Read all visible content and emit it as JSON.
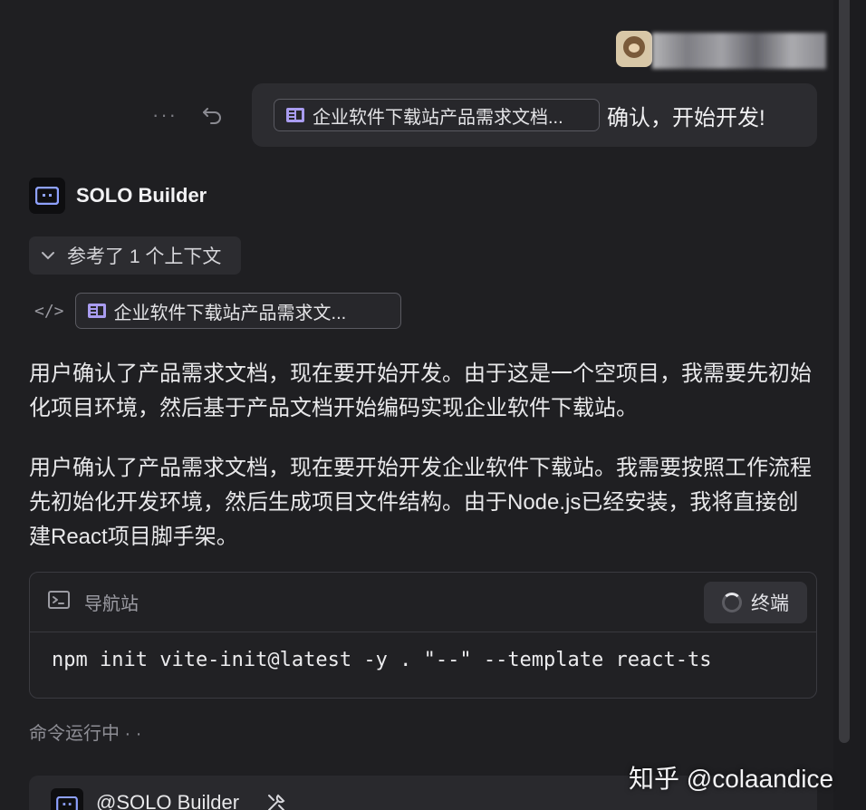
{
  "user": {
    "avatar_icon": "user-avatar-image",
    "name_blurred": true
  },
  "user_message": {
    "attachment_label": "企业软件下载站产品需求文档...",
    "text": "确认，开始开发!",
    "more_icon": "more-dots-icon",
    "undo_icon": "undo-icon"
  },
  "assistant": {
    "name": "SOLO Builder",
    "context_toggle_label": "参考了 1 个上下文",
    "context_ref_label": "企业软件下载站产品需求文...",
    "paragraphs": [
      "用户确认了产品需求文档，现在要开始开发。由于这是一个空项目，我需要先初始化项目环境，然后基于产品文档开始编码实现企业软件下载站。",
      "用户确认了产品需求文档，现在要开始开发企业软件下载站。我需要按照工作流程先初始化开发环境，然后生成项目文件结构。由于Node.js已经安装，我将直接创建React项目脚手架。"
    ]
  },
  "terminal": {
    "title": "导航站",
    "stop_label": "终端",
    "command": "npm init vite-init@latest -y . \"--\" --template react-ts"
  },
  "status": {
    "text": "命令运行中 · ·"
  },
  "next_message": {
    "name": "@SOLO Builder"
  },
  "watermark": {
    "text": "知乎 @colaandice"
  },
  "colors": {
    "background": "#1f1f22",
    "bubble": "#2c2c30",
    "doc_icon": "#a99cf0"
  }
}
